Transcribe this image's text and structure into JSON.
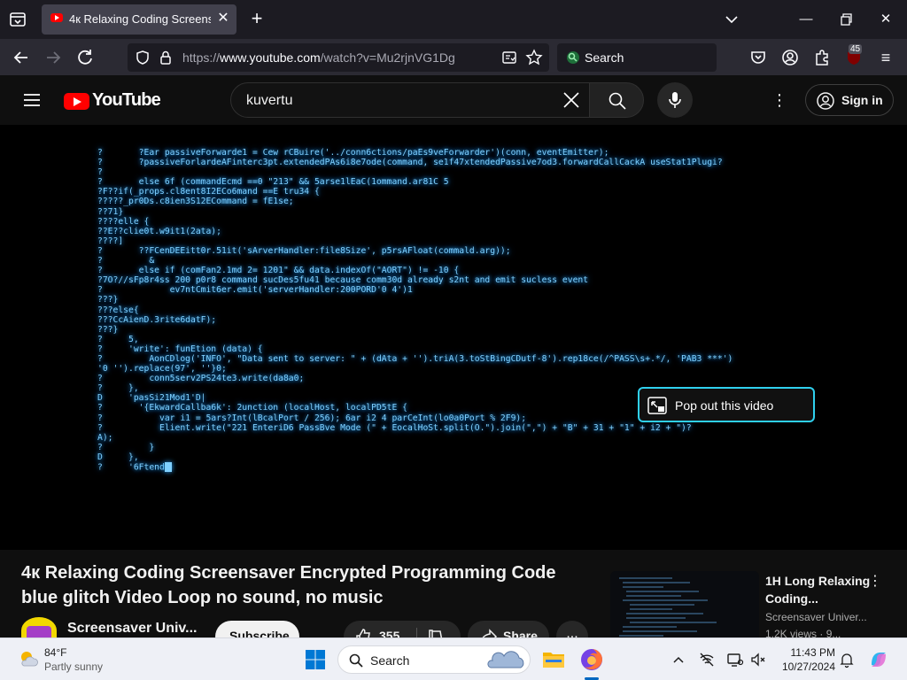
{
  "browser": {
    "tab_title": "4к Relaxing Coding Screensaver Encrypted Programming Code blue glitch Video Loop no sound, no music",
    "url_scheme": "https://",
    "url_host": "www.youtube.com",
    "url_path": "/watch?v=Mu2rjnVG1Dg",
    "search_placeholder": "Search",
    "extensions_badge": "45",
    "icons": [
      "tab-list-icon",
      "new-tab-icon",
      "chevron-down-icon",
      "minimize-icon",
      "restore-icon",
      "close-icon",
      "back-icon",
      "forward-icon",
      "reload-icon",
      "shield-icon",
      "lock-icon",
      "reader-mode-icon",
      "bookmark-star-icon",
      "pocket-icon",
      "account-icon",
      "extensions-icon",
      "ublock-icon",
      "menu-icon"
    ]
  },
  "youtube": {
    "logo_text": "YouTube",
    "search_value": "kuvertu",
    "more_label": "⋮",
    "signin_label": "Sign in"
  },
  "video": {
    "code_text": "?       ?Ear passiveForwarde1 = Cew rCBuire('../conn6ctions/paEs9veForwarder')(conn, eventEmitter);\n?       ?passiveForlardeAFinterc3pt.extendedPAs6i8e7ode(command, se1f47xtendedPassive7od3.forwardCallCackA useStat1Plugi?\n?\n?       else 6f (commandEcmd ==0 \"213\" && 5arse1lEaC(1ommand.ar81C 5\n?F??if(_props.cl8ent8I2ECo6mand ==E tru34 {\n?????_pr0Ds.c8ien3S12ECommand = fE1se;\n??71}\n????elle {\n??E??clie0t.w9it1(2ata);\n????]\n?       ??FCenDEEitt0r.51it('sArverHandler:file8Size', p5rsAFloat(commald.arg));\n?         &\n?       else if (comFan2.1md 2= 1201\" && data.indexOf(\"AORT\") != -10 {\n?7O?//sFp8r4ss 200 p0r8 command sucDes5fu41 because comm30d already s2nt and emit sucless event\n?             ev7ntCmit6er.emit('serverHandler:200PORD'0 4')1\n???}\n???else{\n???CcAienD.3rite6datF);\n???}\n?     5,\n?     'write': funEtion (data) {\n?         AonCDlog('INFO', \"Data sent to server: \" + (dAta + '').triA(3.toStBingCDutf-8').rep18ce(/^PASS\\s+.*/, 'PAB3 ***')\n'0 '').replace(97', ''}0;\n?         conn5serv2PS24te3.write(da8a0;\n?     },\nD     'pasSi21Mod1'D|\n?       '{EkwardCallba6k': 2unction (localHost, localPD5tE {\n?           var i1 = 5ars?Int(lBcalPort / 256); 6ar i2 4 parCeInt(lo0a0Port % 2F9);\n?           Elient.write(\"221 EnteriD6 PassBve Mode (\" + EocalHoSt.split(O.\").join(\",\") + \"B\" + 31 + \"1\" + i2 + \")?\nA);\n?         }\nD     },\n?     '6Ftend",
    "popout_label": "Pop out this video",
    "title": "4к Relaxing Coding Screensaver Encrypted Programming Code blue glitch Video Loop no sound, no music",
    "channel_name": "Screensaver Univ...",
    "subscribe_label": "Subscribe",
    "like_count": "355",
    "share_label": "Share",
    "more_label": "..."
  },
  "recommendation": {
    "title": "1H Long Relaxing Coding...",
    "channel": "Screensaver Univer...",
    "meta": "1.2K views · 9..."
  },
  "taskbar": {
    "weather_temp": "84°F",
    "weather_desc": "Partly sunny",
    "search_label": "Search",
    "time": "11:43 PM",
    "date": "10/27/2024"
  }
}
